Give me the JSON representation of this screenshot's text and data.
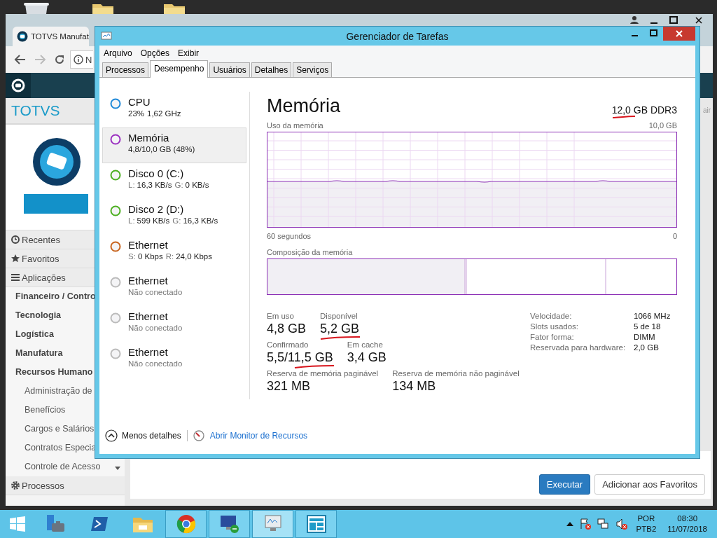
{
  "browser": {
    "tab_title": "TOTVS Manufat",
    "address": "N",
    "brand": "TOTVS",
    "header_right": "air",
    "sidebar": [
      {
        "label": "Recentes",
        "kind": "section"
      },
      {
        "label": "Favoritos",
        "kind": "section"
      },
      {
        "label": "Aplicações",
        "kind": "section",
        "children": [
          {
            "label": "Financeiro / Contro"
          },
          {
            "label": "Tecnologia"
          },
          {
            "label": "Logística"
          },
          {
            "label": "Manufatura"
          },
          {
            "label": "Recursos Humano",
            "children": [
              {
                "label": "Administração de"
              },
              {
                "label": "Benefícios"
              },
              {
                "label": "Cargos e Salários"
              },
              {
                "label": "Contratos Especia"
              },
              {
                "label": "Controle de Acesso"
              }
            ]
          }
        ]
      },
      {
        "label": "Processos",
        "kind": "section"
      }
    ],
    "buttons": [
      {
        "label": "Executar",
        "kind": "primary"
      },
      {
        "label": "Adicionar aos Favoritos",
        "kind": "default"
      }
    ]
  },
  "task_manager": {
    "title": "Gerenciador de Tarefas",
    "menu": [
      "Arquivo",
      "Opções",
      "Exibir"
    ],
    "tabs": [
      {
        "label": "Processos",
        "selected": false
      },
      {
        "label": "Desempenho",
        "selected": true
      },
      {
        "label": "Usuários",
        "selected": false
      },
      {
        "label": "Detalhes",
        "selected": false
      },
      {
        "label": "Serviços",
        "selected": false
      }
    ],
    "devices": [
      {
        "name": "CPU",
        "color": "#1e88d8",
        "selected": false,
        "readings": [
          {
            "value": "23%"
          },
          {
            "value": "1,62 GHz"
          }
        ]
      },
      {
        "name": "Memória",
        "color": "#9b30c0",
        "selected": true,
        "readings": [
          {
            "value": "4,8/10,0 GB (48%)"
          }
        ]
      },
      {
        "name": "Disco 0 (C:)",
        "color": "#4caf20",
        "selected": false,
        "readings": [
          {
            "label": "L:",
            "value": "16,3 KB/s"
          },
          {
            "label": "G:",
            "value": "0 KB/s"
          }
        ]
      },
      {
        "name": "Disco 2 (D:)",
        "color": "#4caf20",
        "selected": false,
        "readings": [
          {
            "label": "L:",
            "value": "599 KB/s"
          },
          {
            "label": "G:",
            "value": "16,3 KB/s"
          }
        ]
      },
      {
        "name": "Ethernet",
        "color": "#c8641e",
        "selected": false,
        "readings": [
          {
            "label": "S:",
            "value": "0 Kbps"
          },
          {
            "label": "R:",
            "value": "24,0 Kbps"
          }
        ]
      },
      {
        "name": "Ethernet",
        "color": "#bbbbbb",
        "selected": false,
        "detail": "Não conectado"
      },
      {
        "name": "Ethernet",
        "color": "#bbbbbb",
        "selected": false,
        "detail": "Não conectado"
      },
      {
        "name": "Ethernet",
        "color": "#bbbbbb",
        "selected": false,
        "detail": "Não conectado"
      }
    ],
    "detail": {
      "title": "Memória",
      "capacity": {
        "text": "12,0 GB DDR3",
        "underlined": true
      },
      "usage_label": "Uso da memória",
      "usage_max": "10,0 GB",
      "time_label": "60 segundos",
      "time_end": "0",
      "composition_label": "Composição da memória",
      "stats": [
        [
          {
            "label": "Em uso",
            "value": "4,8 GB",
            "underlined": false
          },
          {
            "label": "Disponível",
            "value": "5,2 GB",
            "underlined": true
          }
        ],
        [
          {
            "label": "Confirmado",
            "value": "5,5/11,5 GB",
            "underlined": true
          },
          {
            "label": "Em cache",
            "value": "3,4 GB",
            "underlined": false
          }
        ],
        [
          {
            "label": "Reserva de memória paginável",
            "value": "321 MB",
            "underlined": false
          },
          {
            "label": "Reserva de memória não paginável",
            "value": "134 MB",
            "underlined": false
          }
        ]
      ],
      "specs": [
        {
          "label": "Velocidade:",
          "value": "1066 MHz"
        },
        {
          "label": "Slots usados:",
          "value": "5 de 18"
        },
        {
          "label": "Fator forma:",
          "value": "DIMM"
        },
        {
          "label": "Reservada para hardware:",
          "value": "2,0 GB"
        }
      ]
    },
    "footer": {
      "less_details": "Menos detalhes",
      "link": "Abrir Monitor de Recursos"
    }
  },
  "taskbar": {
    "apps": [
      {
        "running": false,
        "selected": false
      },
      {
        "running": false,
        "selected": false
      },
      {
        "running": false,
        "selected": false
      },
      {
        "running": true,
        "selected": false
      },
      {
        "running": true,
        "selected": false
      },
      {
        "running": true,
        "selected": true
      },
      {
        "running": true,
        "selected": false
      }
    ],
    "language": "POR",
    "layout": "PTB2",
    "time": "08:30",
    "date": "11/07/2018"
  }
}
